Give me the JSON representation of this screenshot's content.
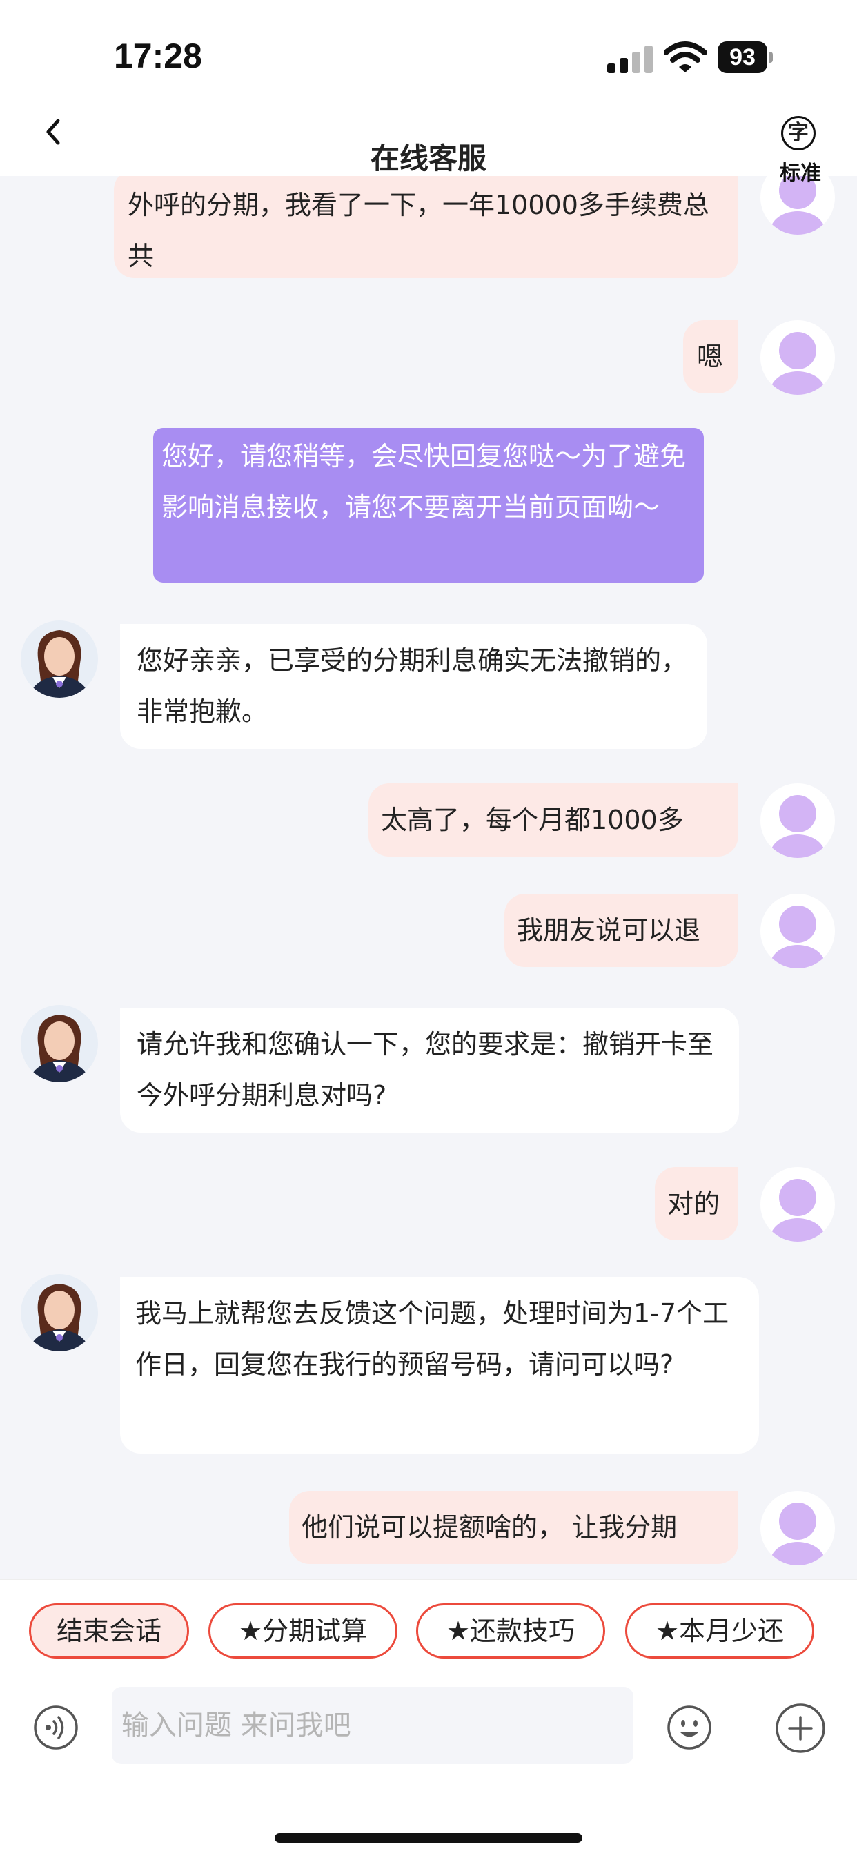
{
  "status_bar": {
    "time": "17:28",
    "battery": "93"
  },
  "header": {
    "title": "在线客服",
    "font_size_icon_char": "字",
    "font_size_label": "标准"
  },
  "messages": [
    {
      "role": "user",
      "text": "外呼的分期，我看了一下，一年10000多手续费总共"
    },
    {
      "role": "user",
      "text": "嗯"
    },
    {
      "role": "system",
      "text": "您好，请您稍等，会尽快回复您哒～为了避免影响消息接收，请您不要离开当前页面呦～"
    },
    {
      "role": "agent",
      "text": "您好亲亲，已享受的分期利息确实无法撤销的，非常抱歉。"
    },
    {
      "role": "user",
      "text": "太高了，每个月都1000多"
    },
    {
      "role": "user",
      "text": "我朋友说可以退"
    },
    {
      "role": "agent",
      "text": "请允许我和您确认一下，您的要求是：撤销开卡至今外呼分期利息对吗?"
    },
    {
      "role": "user",
      "text": "对的"
    },
    {
      "role": "agent",
      "text": "我马上就帮您去反馈这个问题，处理时间为1-7个工作日，回复您在我行的预留号码，请问可以吗?"
    },
    {
      "role": "user",
      "text": "他们说可以提额啥的， 让我分期"
    }
  ],
  "quick_actions": [
    "结束会话",
    "★分期试算",
    "★还款技巧",
    "★本月少还"
  ],
  "input": {
    "placeholder": "输入问题 来问我吧",
    "value": ""
  },
  "colors": {
    "accent": "#ec4a3c",
    "user_bubble": "#fde9e6",
    "system_bubble": "#a88df2",
    "chat_background": "#f4f5f9",
    "user_avatar": "#d3b4f5"
  }
}
